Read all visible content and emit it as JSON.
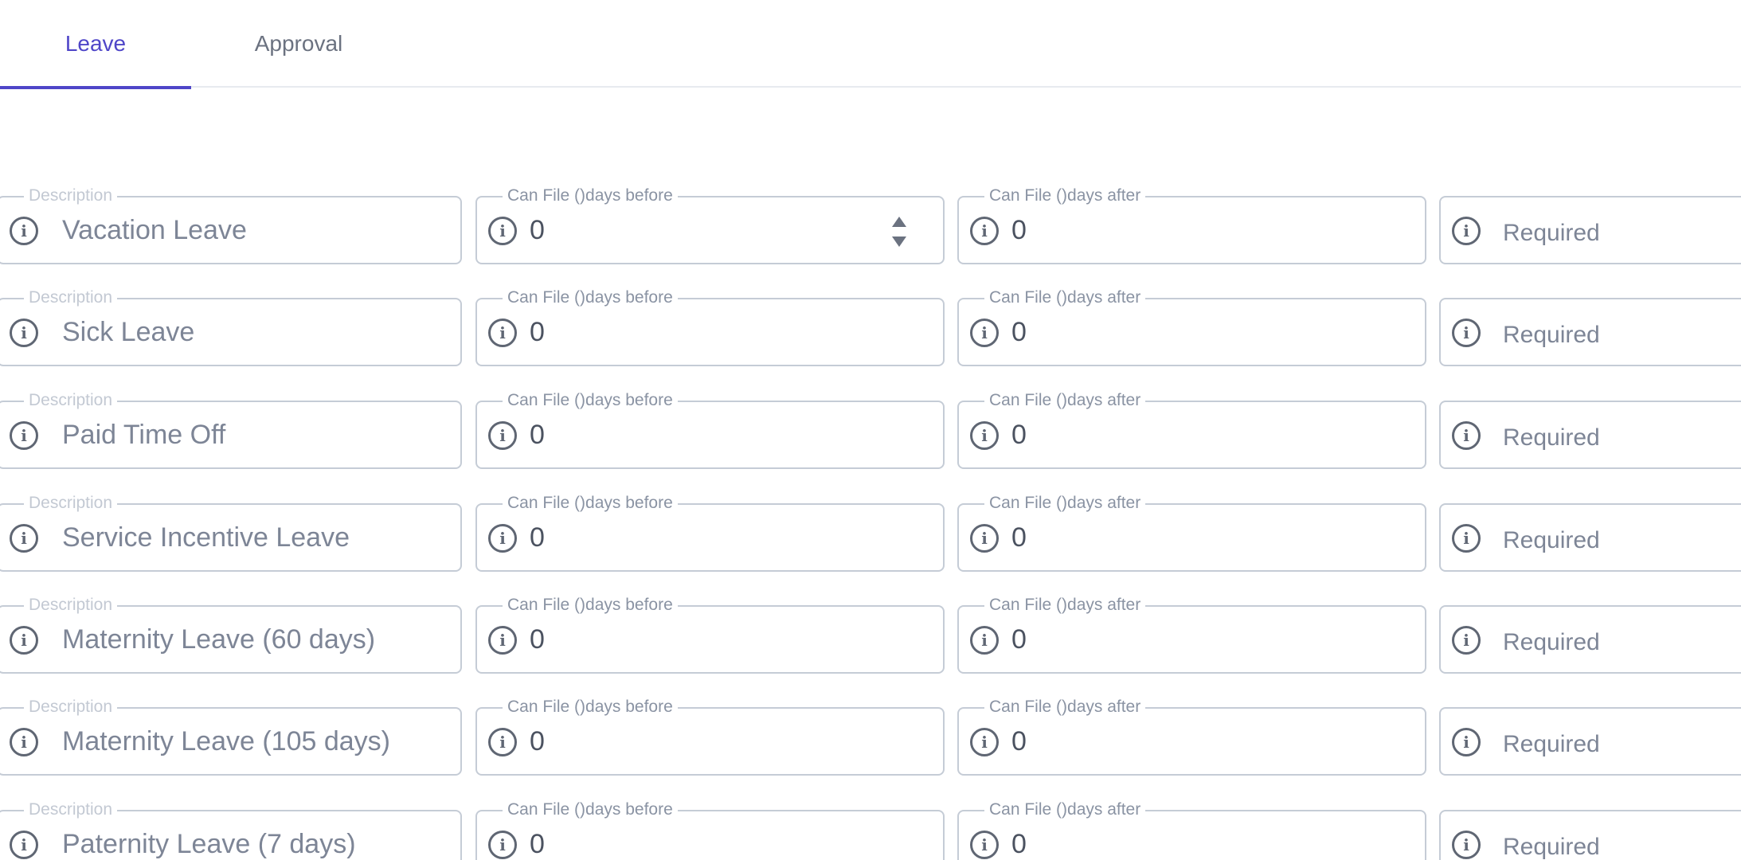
{
  "tabs": [
    {
      "label": "Leave",
      "active": true
    },
    {
      "label": "Approval",
      "active": false
    }
  ],
  "labels": {
    "description": "Description",
    "before": "Can File ()days before",
    "after": "Can File ()days after",
    "required": "Required"
  },
  "rows": [
    {
      "description": "Vacation Leave",
      "before": "0",
      "after": "0"
    },
    {
      "description": "Sick Leave",
      "before": "0",
      "after": "0"
    },
    {
      "description": "Paid Time Off",
      "before": "0",
      "after": "0"
    },
    {
      "description": "Service Incentive Leave",
      "before": "0",
      "after": "0"
    },
    {
      "description": "Maternity Leave (60 days)",
      "before": "0",
      "after": "0"
    },
    {
      "description": "Maternity Leave (105 days)",
      "before": "0",
      "after": "0"
    },
    {
      "description": "Paternity Leave (7 days)",
      "before": "0",
      "after": "0"
    }
  ],
  "colors": {
    "accent": "#4f46c8",
    "border": "#c5ccd6",
    "icon": "#5f6673"
  }
}
